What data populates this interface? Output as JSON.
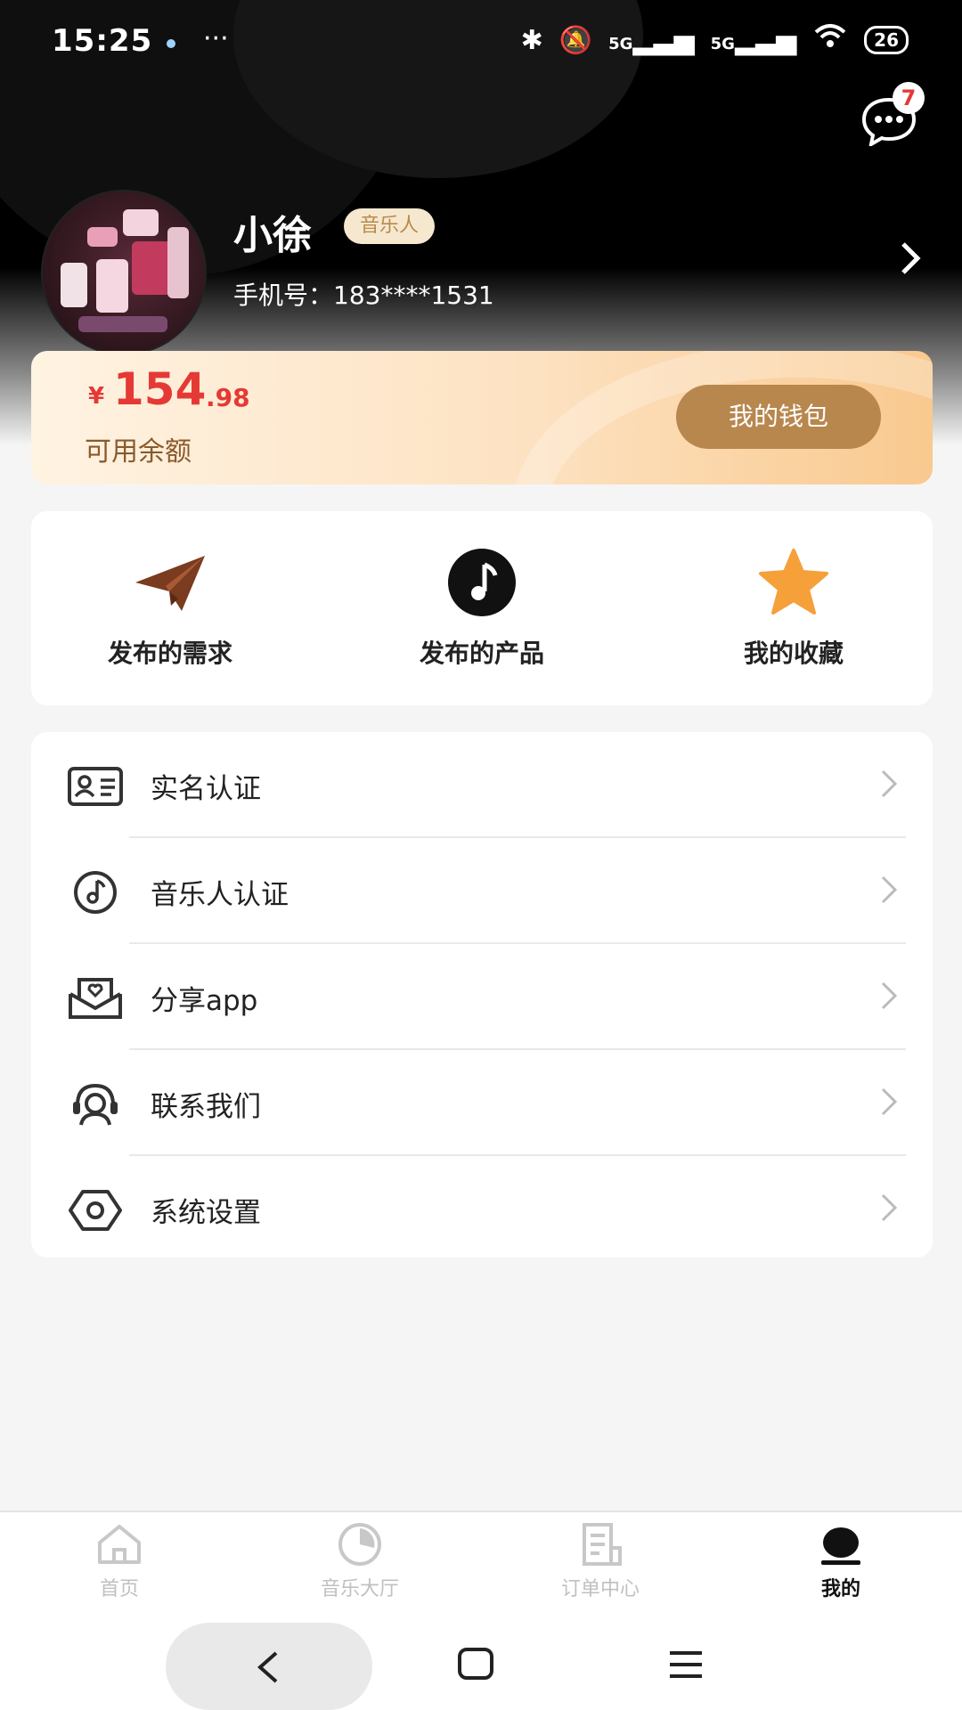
{
  "status_bar": {
    "time": "15:25",
    "more": "···",
    "network_1": "5G",
    "network_2": "5G",
    "battery": "26"
  },
  "header": {
    "message_count": "7"
  },
  "profile": {
    "name": "小徐",
    "role_badge": "音乐人",
    "phone": "手机号：183****1531"
  },
  "wallet": {
    "currency": "¥",
    "amount_int": "154",
    "amount_dec": ".98",
    "balance_label": "可用余额",
    "button_label": "我的钱包"
  },
  "quick_actions": [
    {
      "label": "发布的需求",
      "icon": "paper-plane-icon",
      "color": "#7a3b1f"
    },
    {
      "label": "发布的产品",
      "icon": "music-note-icon",
      "color": "#111111"
    },
    {
      "label": "我的收藏",
      "icon": "star-icon",
      "color": "#f6a03a"
    }
  ],
  "menu": [
    {
      "label": "实名认证",
      "icon": "id-card-icon"
    },
    {
      "label": "音乐人认证",
      "icon": "music-disc-icon"
    },
    {
      "label": "分享app",
      "icon": "share-envelope-icon"
    },
    {
      "label": "联系我们",
      "icon": "customer-service-icon"
    },
    {
      "label": "系统设置",
      "icon": "settings-hexagon-icon"
    }
  ],
  "tabs": [
    {
      "label": "首页",
      "icon": "home-icon"
    },
    {
      "label": "音乐大厅",
      "icon": "music-hall-icon"
    },
    {
      "label": "订单中心",
      "icon": "order-icon"
    },
    {
      "label": "我的",
      "icon": "profile-icon",
      "active": true
    }
  ]
}
